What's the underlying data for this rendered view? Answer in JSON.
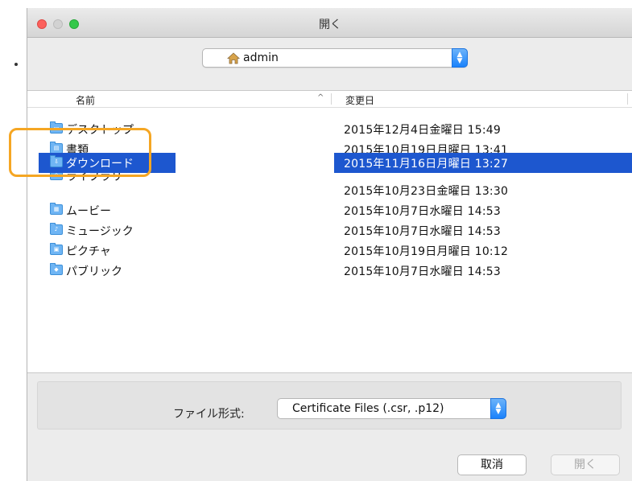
{
  "window": {
    "title": "開く"
  },
  "location": {
    "current": "admin"
  },
  "columns": {
    "name": "名前",
    "sort_indicator": "^",
    "date": "変更日"
  },
  "files": [
    {
      "name": "デスクトップ",
      "date": "2015年12月4日金曜日 15:49",
      "icon": "desktop-folder-icon",
      "glyph": "▭"
    },
    {
      "name": "書類",
      "date": "2015年10月19日月曜日 13:41",
      "icon": "documents-folder-icon",
      "glyph": "▤"
    },
    {
      "name": "ダウンロード",
      "date": "2015年11月16日月曜日 13:27",
      "icon": "downloads-folder-icon",
      "glyph": "⇩"
    },
    {
      "name": "ライブラリ",
      "date": "2015年10月23日金曜日 13:30",
      "icon": "library-folder-icon",
      "glyph": "⌂"
    },
    {
      "name": "ムービー",
      "date": "2015年10月7日水曜日 14:53",
      "icon": "movies-folder-icon",
      "glyph": "▦"
    },
    {
      "name": "ミュージック",
      "date": "2015年10月7日水曜日 14:53",
      "icon": "music-folder-icon",
      "glyph": "♪"
    },
    {
      "name": "ピクチャ",
      "date": "2015年10月19日月曜日 10:12",
      "icon": "pictures-folder-icon",
      "glyph": "▣"
    },
    {
      "name": "パブリック",
      "date": "2015年10月7日水曜日 14:53",
      "icon": "public-folder-icon",
      "glyph": "◆"
    }
  ],
  "selected_index": 2,
  "format": {
    "label": "ファイル形式:",
    "value": "Certificate Files (.csr, .p12)"
  },
  "buttons": {
    "cancel": "取消",
    "open": "開く"
  },
  "colors": {
    "selection": "#1d57cf",
    "highlight_ring": "#f5a623",
    "folder": "#6fb5f4"
  }
}
